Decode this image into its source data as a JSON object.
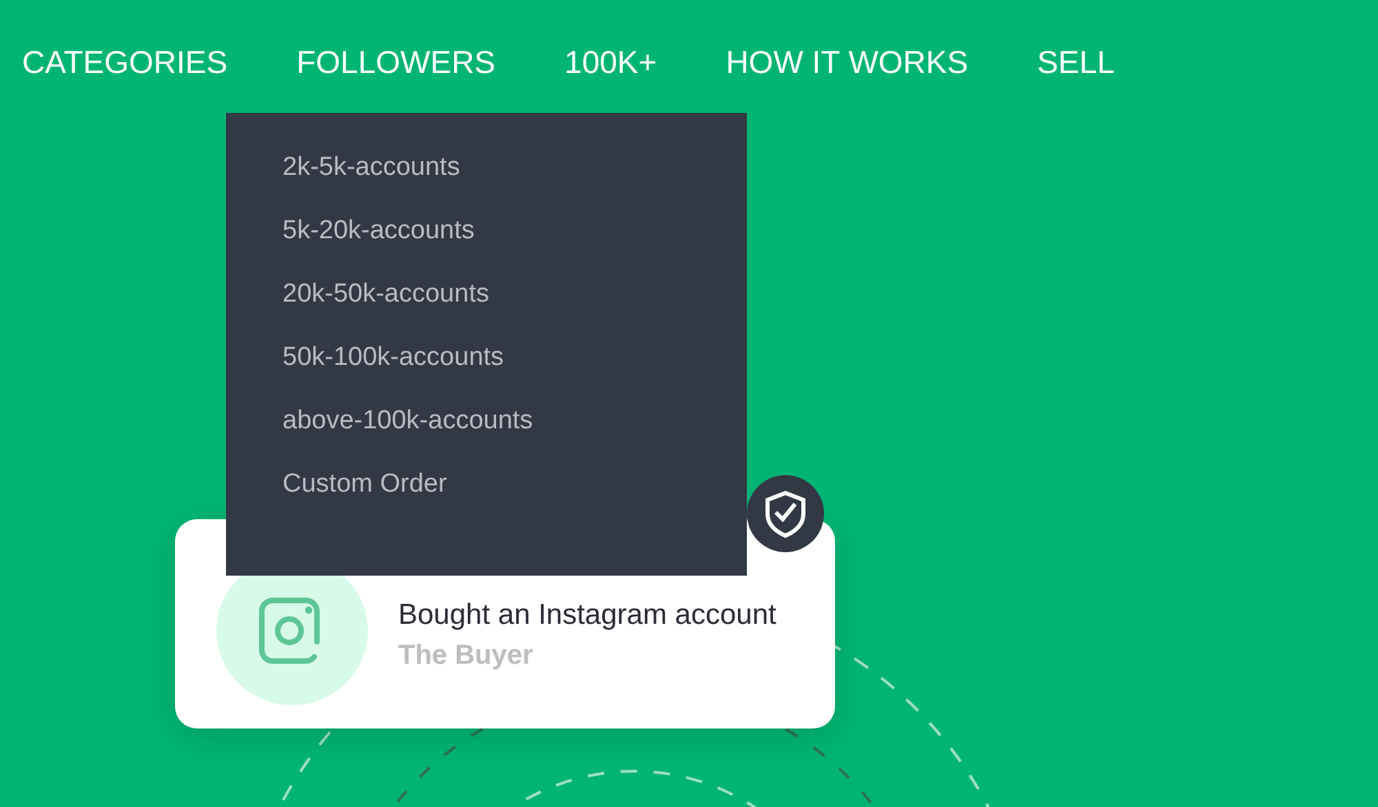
{
  "nav": {
    "items": [
      {
        "label": "CATEGORIES"
      },
      {
        "label": "FOLLOWERS",
        "expanded": true
      },
      {
        "label": "100K+"
      },
      {
        "label": "HOW IT WORKS"
      },
      {
        "label": "SELL"
      }
    ]
  },
  "dropdown": {
    "items": [
      "2k-5k-accounts",
      "5k-20k-accounts",
      "20k-50k-accounts",
      "50k-100k-accounts",
      "above-100k-accounts",
      "Custom Order"
    ]
  },
  "card": {
    "action": "Bought an Instagram account",
    "role": "The Buyer",
    "verified": true
  }
}
